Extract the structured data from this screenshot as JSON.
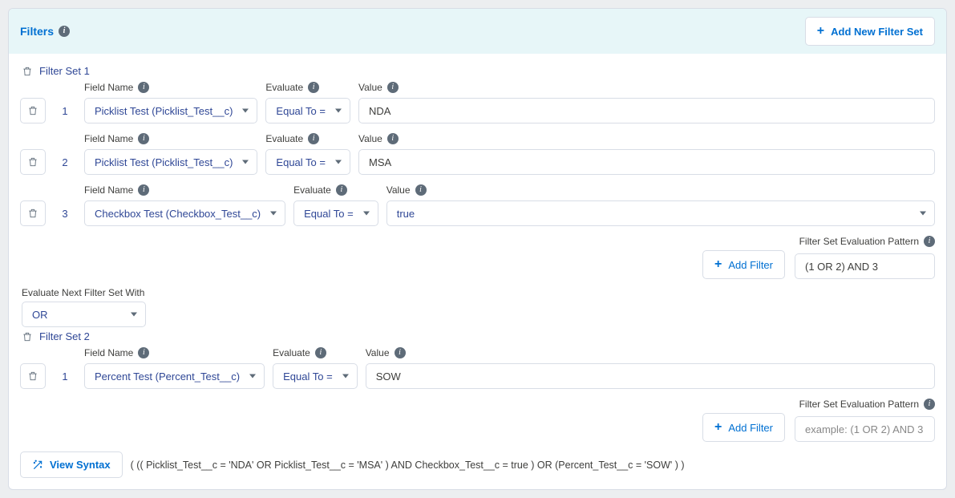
{
  "header": {
    "title": "Filters",
    "add_new_set_label": "Add New Filter Set"
  },
  "labels": {
    "field_name": "Field Name",
    "evaluate": "Evaluate",
    "value": "Value",
    "add_filter": "Add Filter",
    "pattern": "Filter Set Evaluation Pattern",
    "eval_next": "Evaluate Next Filter Set With",
    "view_syntax": "View Syntax",
    "pattern_placeholder": "example: (1 OR 2) AND 3"
  },
  "sets": [
    {
      "title": "Filter Set 1",
      "rows": [
        {
          "num": "1",
          "field": "Picklist Test (Picklist_Test__c)",
          "evaluate": "Equal To =",
          "value": "NDA",
          "value_has_caret": false
        },
        {
          "num": "2",
          "field": "Picklist Test (Picklist_Test__c)",
          "evaluate": "Equal To =",
          "value": "MSA",
          "value_has_caret": false
        },
        {
          "num": "3",
          "field": "Checkbox Test (Checkbox_Test__c)",
          "evaluate": "Equal To =",
          "value": "true",
          "value_has_caret": true
        }
      ],
      "pattern": "(1 OR 2) AND 3",
      "pattern_is_placeholder": false,
      "next_logic": "OR",
      "show_next_logic": true
    },
    {
      "title": "Filter Set 2",
      "rows": [
        {
          "num": "1",
          "field": "Percent Test (Percent_Test__c)",
          "evaluate": "Equal To =",
          "value": "SOW",
          "value_has_caret": false
        }
      ],
      "pattern": "",
      "pattern_is_placeholder": true,
      "show_next_logic": false
    }
  ],
  "syntax": "( (( Picklist_Test__c = 'NDA' OR Picklist_Test__c = 'MSA' ) AND Checkbox_Test__c = true ) OR (Percent_Test__c = 'SOW' ) )"
}
